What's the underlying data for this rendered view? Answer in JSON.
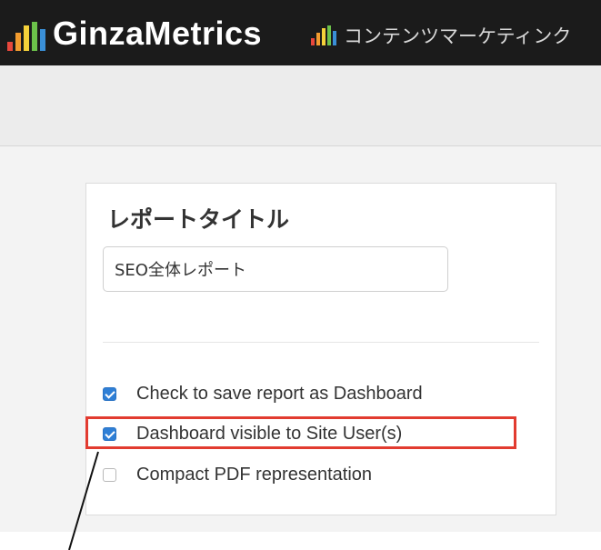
{
  "header": {
    "logo_text": "GinzaMetrics",
    "app_title": "コンテンツマーケティンク",
    "logo_icon": "bar-chart-logo-icon",
    "bar_colors": [
      "#e8473c",
      "#f39c2f",
      "#f5d13a",
      "#6cc24a",
      "#3a8fd6"
    ]
  },
  "report": {
    "title_label": "レポートタイトル",
    "title_value": "SEO全体レポート"
  },
  "options": [
    {
      "label": "Check to save report as Dashboard",
      "checked": true
    },
    {
      "label": "Dashboard visible to Site User(s)",
      "checked": true
    },
    {
      "label": "Compact PDF representation",
      "checked": false
    }
  ],
  "annotation": {
    "highlight_color": "#e23b30"
  }
}
